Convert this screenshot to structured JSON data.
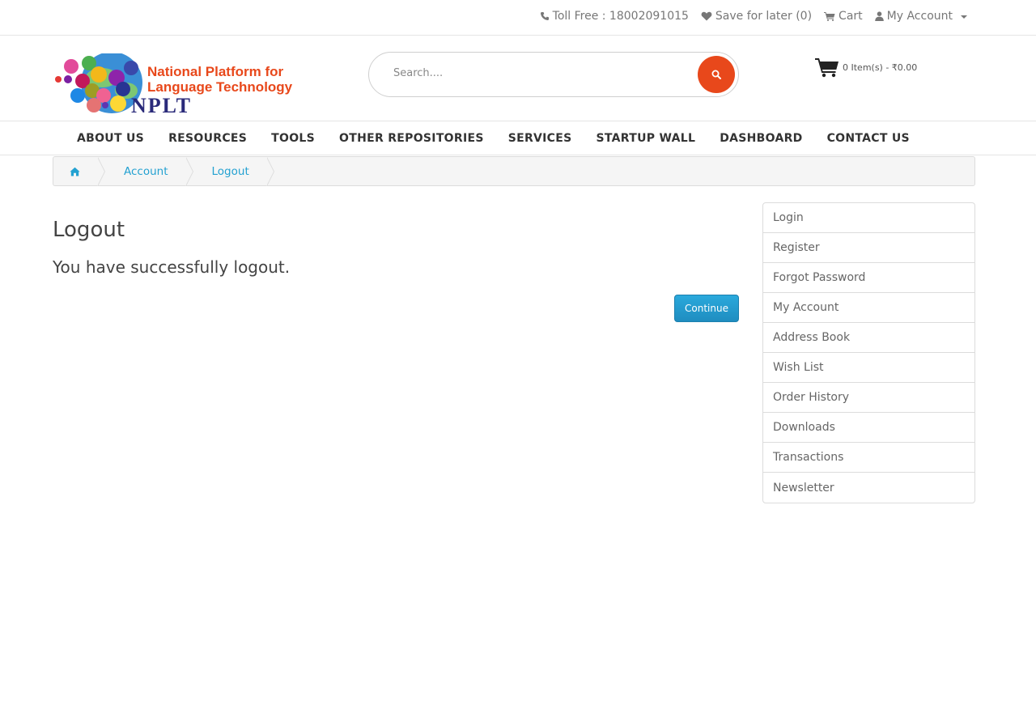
{
  "topbar": {
    "toll_free": "Toll Free : 18002091015",
    "save_for_later": "Save for later (0)",
    "cart": "Cart",
    "my_account": "My Account"
  },
  "header": {
    "logo_text_line1": "National Platform for",
    "logo_text_line2": "Language Technology",
    "logo_abbr": "NPLT",
    "search_placeholder": "Search....",
    "cart_summary": "0 Item(s) - ₹0.00"
  },
  "nav": [
    "ABOUT US",
    "RESOURCES",
    "TOOLS",
    "OTHER REPOSITORIES",
    "SERVICES",
    "STARTUP WALL",
    "DASHBOARD",
    "CONTACT US"
  ],
  "breadcrumb": {
    "items": [
      "Account",
      "Logout"
    ]
  },
  "main": {
    "title": "Logout",
    "message": "You have successfully logout.",
    "continue": "Continue"
  },
  "sidebar": {
    "items": [
      "Login",
      "Register",
      "Forgot Password",
      "My Account",
      "Address Book",
      "Wish List",
      "Order History",
      "Downloads",
      "Transactions",
      "Newsletter"
    ]
  },
  "colors": {
    "link": "#23a1d1",
    "button": "#229ac8",
    "search_button": "#e8481b"
  }
}
